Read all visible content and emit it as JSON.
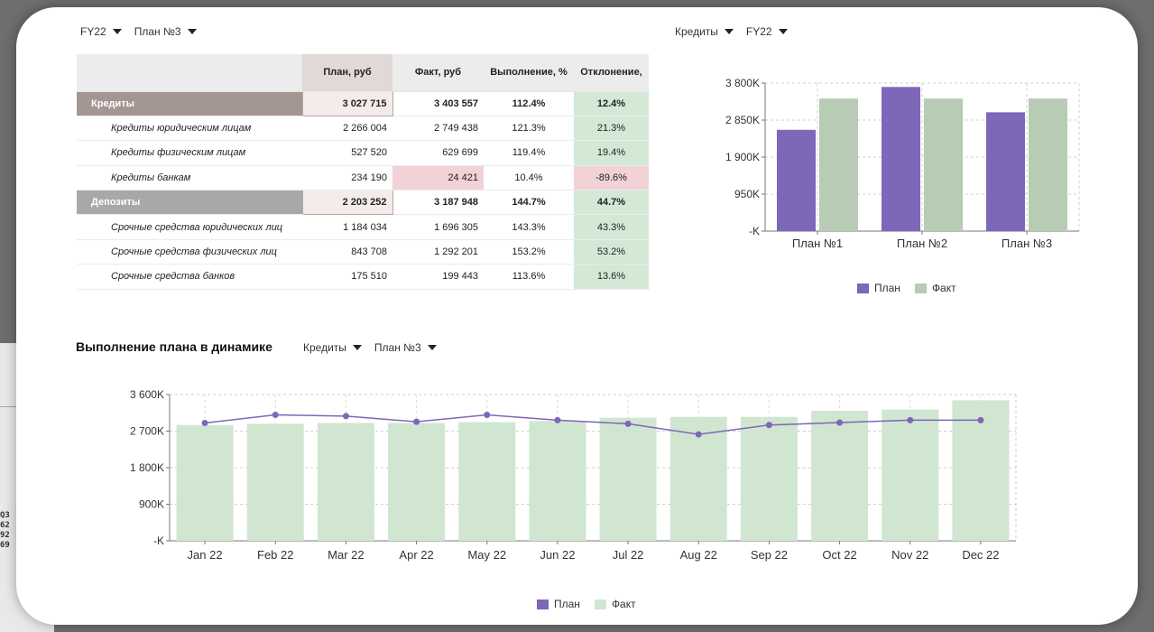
{
  "colors": {
    "plan": "#7e66b8",
    "fact": "#b7cbb5",
    "fact_light": "#d0e6d0",
    "good": "#d3e9d6",
    "bad": "#f2d2d6"
  },
  "backdrop": {
    "fragments": [
      "Q3",
      "62",
      "92",
      "69"
    ]
  },
  "top_filters": [
    {
      "label": "FY22"
    },
    {
      "label": "План №3"
    }
  ],
  "right_filters": [
    {
      "label": "Кредиты"
    },
    {
      "label": "FY22"
    }
  ],
  "table": {
    "headers": [
      "",
      "План, руб",
      "Факт, руб",
      "Выполнение, %",
      "Отклонение,"
    ],
    "rows": [
      {
        "type": "group",
        "group": "cred",
        "name": "Кредиты",
        "plan": "3 027 715",
        "fact": "3 403 557",
        "exec": "112.4%",
        "dev": "12.4%",
        "dev_status": "good",
        "fact_status": ""
      },
      {
        "type": "sub",
        "name": "Кредиты юридическим лицам",
        "plan": "2 266 004",
        "fact": "2 749 438",
        "exec": "121.3%",
        "dev": "21.3%",
        "dev_status": "good",
        "fact_status": ""
      },
      {
        "type": "sub",
        "name": "Кредиты физическим лицам",
        "plan": "527 520",
        "fact": "629 699",
        "exec": "119.4%",
        "dev": "19.4%",
        "dev_status": "good",
        "fact_status": ""
      },
      {
        "type": "sub",
        "name": "Кредиты банкам",
        "plan": "234 190",
        "fact": "24 421",
        "exec": "10.4%",
        "dev": "-89.6%",
        "dev_status": "bad",
        "fact_status": "bad"
      },
      {
        "type": "group",
        "group": "dep",
        "name": "Депозиты",
        "plan": "2 203 252",
        "fact": "3 187 948",
        "exec": "144.7%",
        "dev": "44.7%",
        "dev_status": "good",
        "fact_status": ""
      },
      {
        "type": "sub",
        "name": "Срочные средства юридических лиц",
        "plan": "1 184 034",
        "fact": "1 696 305",
        "exec": "143.3%",
        "dev": "43.3%",
        "dev_status": "good",
        "fact_status": ""
      },
      {
        "type": "sub",
        "name": "Срочные средства физических лиц",
        "plan": "843 708",
        "fact": "1 292 201",
        "exec": "153.2%",
        "dev": "53.2%",
        "dev_status": "good",
        "fact_status": ""
      },
      {
        "type": "sub",
        "name": "Срочные средства банков",
        "plan": "175 510",
        "fact": "199 443",
        "exec": "113.6%",
        "dev": "13.6%",
        "dev_status": "good",
        "fact_status": ""
      }
    ]
  },
  "section": {
    "title": "Выполнение плана в динамике",
    "filters": [
      {
        "label": "Кредиты"
      },
      {
        "label": "План №3"
      }
    ]
  },
  "legend": {
    "plan": "План",
    "fact": "Факт"
  },
  "chart_data": [
    {
      "type": "bar",
      "categories": [
        "План №1",
        "План №2",
        "План №3"
      ],
      "series": [
        {
          "name": "План",
          "values": [
            2600000,
            3700000,
            3050000
          ]
        },
        {
          "name": "Факт",
          "values": [
            3403557,
            3403557,
            3403557
          ]
        }
      ],
      "ylim": [
        0,
        3800000
      ],
      "yticks": [
        0,
        950000,
        1900000,
        2850000,
        3800000
      ],
      "ytick_labels": [
        "-K",
        "950K",
        "1 900K",
        "2 850K",
        "3 800K"
      ],
      "grid": true,
      "legend": "bottom"
    },
    {
      "type": "bar",
      "categories": [
        "Jan 22",
        "Feb 22",
        "Mar 22",
        "Apr 22",
        "May 22",
        "Jun 22",
        "Jul 22",
        "Aug 22",
        "Sep 22",
        "Oct 22",
        "Nov 22",
        "Dec 22"
      ],
      "series": [
        {
          "name": "План",
          "kind": "line",
          "values": [
            2900000,
            3100000,
            3070000,
            2930000,
            3100000,
            2970000,
            2880000,
            2620000,
            2850000,
            2910000,
            2970000,
            2970000
          ]
        },
        {
          "name": "Факт",
          "kind": "bar",
          "values": [
            2850000,
            2880000,
            2900000,
            2900000,
            2920000,
            2950000,
            3030000,
            3050000,
            3050000,
            3200000,
            3230000,
            3460000
          ]
        }
      ],
      "ylim": [
        0,
        3600000
      ],
      "yticks": [
        0,
        900000,
        1800000,
        2700000,
        3600000
      ],
      "ytick_labels": [
        "-K",
        "900K",
        "1 800K",
        "2 700K",
        "3 600K"
      ],
      "grid": true,
      "legend": "bottom"
    }
  ]
}
